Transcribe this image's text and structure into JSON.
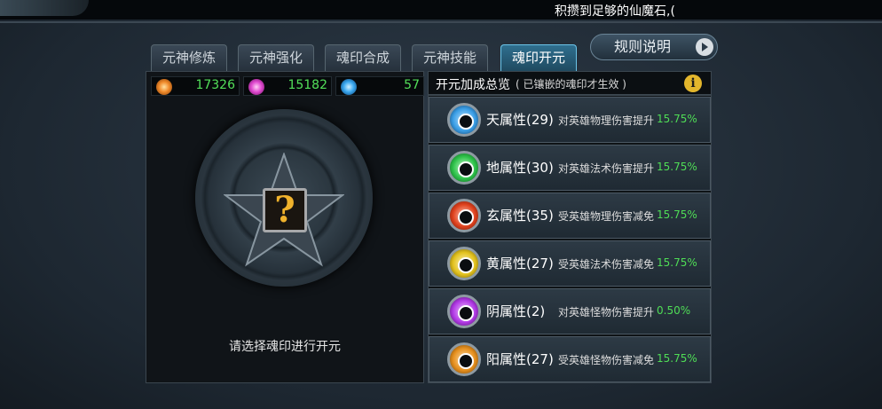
{
  "marquee": "积攒到足够的仙魔石,(",
  "tabs": [
    {
      "label": "元神修炼"
    },
    {
      "label": "元神强化"
    },
    {
      "label": "魂印合成"
    },
    {
      "label": "元神技能"
    },
    {
      "label": "魂印开元",
      "active": true
    }
  ],
  "rules_button": "规则说明",
  "currencies": [
    {
      "icon": "orange-swirl-icon",
      "value": "17326",
      "color": "#f08a2a"
    },
    {
      "icon": "pink-swirl-icon",
      "value": "15182",
      "color": "#e04ad0"
    },
    {
      "icon": "blue-swirl-icon",
      "value": "57",
      "color": "#3aa8f0"
    }
  ],
  "disk": {
    "placeholder": "?",
    "hint": "请选择魂印进行开元"
  },
  "overview": {
    "title": "开元加成总览",
    "subtitle": "( 已镶嵌的魂印才生效 )",
    "info_icon": "i"
  },
  "attributes": [
    {
      "name": "天属性(29)",
      "desc": "对英雄物理伤害提升",
      "pct": "15.75%",
      "color": "#3a9ee6"
    },
    {
      "name": "地属性(30)",
      "desc": "对英雄法术伤害提升",
      "pct": "15.75%",
      "color": "#2ec24a"
    },
    {
      "name": "玄属性(35)",
      "desc": "受英雄物理伤害减免",
      "pct": "15.75%",
      "color": "#e0421e"
    },
    {
      "name": "黄属性(27)",
      "desc": "受英雄法术伤害减免",
      "pct": "15.75%",
      "color": "#e3c21e"
    },
    {
      "name": "阴属性(2)",
      "desc": "对英雄怪物伤害提升",
      "pct": "0.50%",
      "color": "#b23ae6"
    },
    {
      "name": "阳属性(27)",
      "desc": "受英雄怪物伤害减免",
      "pct": "15.75%",
      "color": "#e6901e"
    }
  ]
}
